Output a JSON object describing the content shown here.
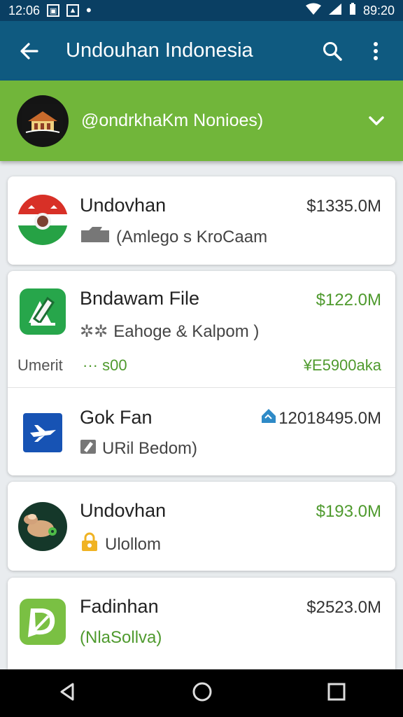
{
  "status_bar": {
    "time": "12:06",
    "right_time": "89:20"
  },
  "app_bar": {
    "title": "Undouhan Indonesia"
  },
  "account": {
    "name": "@ondrkhaKm Nonioes)"
  },
  "items": [
    {
      "title": "Undovhan",
      "price": "$1335.0M",
      "subtitle": "(Amlego s KroCaam",
      "price_color": "#333333",
      "icon": "flag-emblem-icon"
    },
    {
      "title": "Bndawam File",
      "price": "$122.0M",
      "subtitle": "Eahoge & Kalpom )",
      "price_color": "#4f9a2e",
      "icon": "green-edit-app-icon",
      "extra_left": "Umerit",
      "extra_mid": "··· s00",
      "extra_right": "¥E5900aka"
    },
    {
      "title": "Gok Fan",
      "price": "12018495.0M",
      "subtitle": "URil Bedom)",
      "price_color": "#333333",
      "icon": "blue-plane-app-icon"
    },
    {
      "title": "Undovhan",
      "price": "$193.0M",
      "subtitle": "Ulollom",
      "price_color": "#4f9a2e",
      "icon": "animal-avatar-icon"
    },
    {
      "title": "Fadinhan",
      "price": "$2523.0M",
      "subtitle": "(NlaSollva)",
      "price_color": "#333333",
      "icon": "green-leaf-app-icon"
    }
  ]
}
